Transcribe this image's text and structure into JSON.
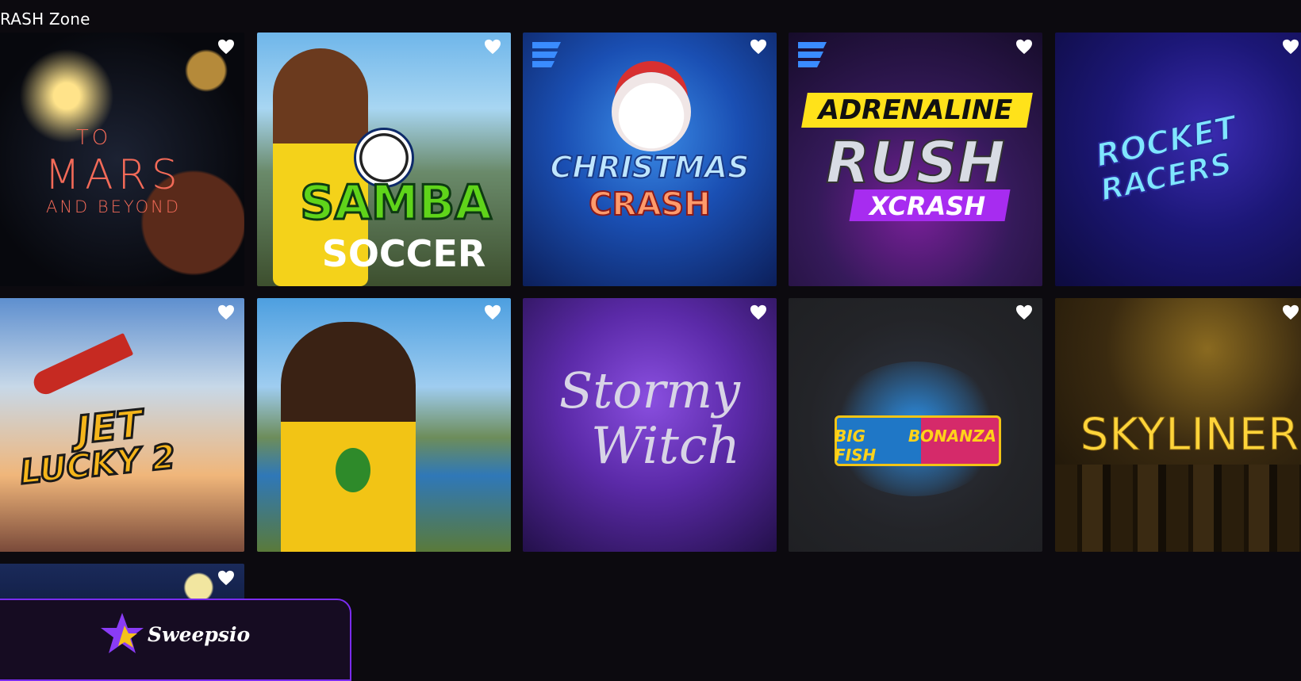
{
  "section": {
    "title": "RASH Zone"
  },
  "games": [
    {
      "title_line1": "TO",
      "title_line2": "MARS",
      "title_line3": "AND BEYOND",
      "favorite_icon": "heart-icon"
    },
    {
      "title_line1": "SAMBA",
      "title_line2": "SOCCER",
      "favorite_icon": "heart-icon"
    },
    {
      "title_line1": "CHRISTMAS",
      "title_line2": "CRASH",
      "favorite_icon": "heart-icon"
    },
    {
      "title_line1": "ADRENALINE",
      "title_line2": "RUSH",
      "title_line3": "XCRASH",
      "favorite_icon": "heart-icon"
    },
    {
      "title_line1": "ROCKET",
      "title_line2": "RACERS",
      "favorite_icon": "heart-icon"
    },
    {
      "title_line1": "JET",
      "title_line2": "LUCKY 2",
      "favorite_icon": "heart-icon"
    },
    {
      "favorite_icon": "heart-icon"
    },
    {
      "title_line1": "Stormy",
      "title_line2": "Witch",
      "favorite_icon": "heart-icon"
    },
    {
      "title_line1": "BIG FISH",
      "title_line2": "BONANZA",
      "favorite_icon": "heart-icon"
    },
    {
      "title_line1": "SKYLINER",
      "favorite_icon": "heart-icon"
    },
    {
      "favorite_icon": "heart-icon"
    }
  ],
  "brand": {
    "name": "Sweepsio",
    "icon": "star-logo-icon"
  },
  "colors": {
    "background": "#0c0a0f",
    "accent": "#7b2cf0"
  }
}
